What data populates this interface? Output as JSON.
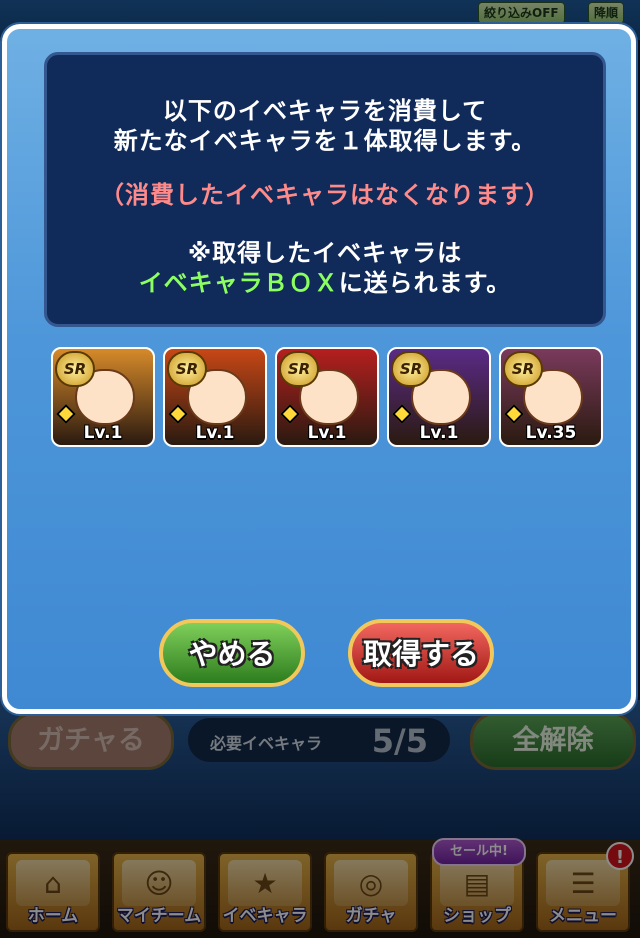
{
  "background": {
    "filters": [
      "絞り込みOFF",
      "降順"
    ],
    "gacha_button": "ガチャる",
    "required_label": "必要イベキャラ",
    "required_count": "5/5",
    "clear_all_button": "全解除"
  },
  "dialog": {
    "line1": "以下のイベキャラを消費して",
    "line2": "新たなイベキャラを１体取得します。",
    "warning": "（消費したイベキャラはなくなります）",
    "note_line1": "※取得したイベキャラは",
    "note_highlight": "イベキャラＢＯＸ",
    "note_suffix": "に送られます。",
    "characters": [
      {
        "rank": "SR",
        "level": "Lv.1",
        "color": "#d68a2a"
      },
      {
        "rank": "SR",
        "level": "Lv.1",
        "color": "#c74716"
      },
      {
        "rank": "SR",
        "level": "Lv.1",
        "color": "#b51f1f"
      },
      {
        "rank": "SR",
        "level": "Lv.1",
        "color": "#5a2a86"
      },
      {
        "rank": "SR",
        "level": "Lv.35",
        "color": "#7a3a5c"
      }
    ],
    "cancel_button": "やめる",
    "acquire_button": "取得する"
  },
  "bottom_nav": [
    {
      "label": "ホーム",
      "icon": "home-icon"
    },
    {
      "label": "マイチーム",
      "icon": "team-icon"
    },
    {
      "label": "イベキャラ",
      "icon": "event-chara-icon"
    },
    {
      "label": "ガチャ",
      "icon": "gacha-icon"
    },
    {
      "label": "ショップ",
      "icon": "shop-icon"
    },
    {
      "label": "メニュー",
      "icon": "menu-icon"
    }
  ],
  "sale_badge": "セール中!",
  "alert_badge": "!"
}
